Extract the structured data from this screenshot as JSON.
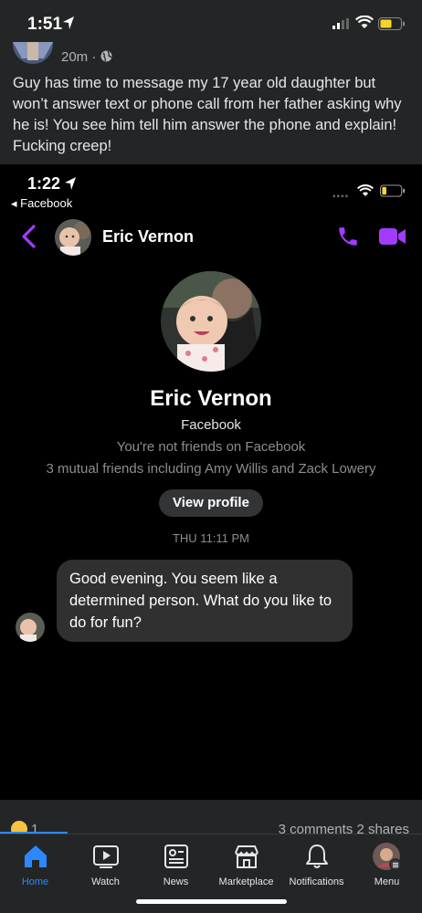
{
  "status_bar": {
    "time": "1:51"
  },
  "post": {
    "time_meta": "20m ·",
    "text": "Guy has time to message my 17 year old daughter but won’t answer text or phone call from her father asking why he is! You see him tell him answer the phone and explain! Fucking creep!"
  },
  "embedded": {
    "time": "1:22",
    "back_app": "◂ Facebook",
    "chat": {
      "contact_name": "Eric Vernon",
      "profile_name": "Eric Vernon",
      "profile_sub": "Facebook",
      "friend_status": "You're not friends on Facebook",
      "mutual": "3 mutual friends including Amy Willis and Zack Lowery",
      "view_profile_label": "View profile",
      "timestamp": "THU 11:11 PM",
      "message": "Good evening. You seem like a determined person. What do you like to do for fun?"
    },
    "accent_color": "#a33bff"
  },
  "reactions": {
    "count": "1",
    "stats": "3 comments  2 shares"
  },
  "nav": [
    {
      "label": "Home",
      "icon": "home-icon",
      "active": true
    },
    {
      "label": "Watch",
      "icon": "watch-icon"
    },
    {
      "label": "News",
      "icon": "news-icon"
    },
    {
      "label": "Marketplace",
      "icon": "marketplace-icon"
    },
    {
      "label": "Notifications",
      "icon": "bell-icon"
    },
    {
      "label": "Menu",
      "icon": "menu-avatar-icon"
    }
  ],
  "colors": {
    "background": "#242526",
    "link_blue": "#2d88ff",
    "bubble": "#303030"
  }
}
